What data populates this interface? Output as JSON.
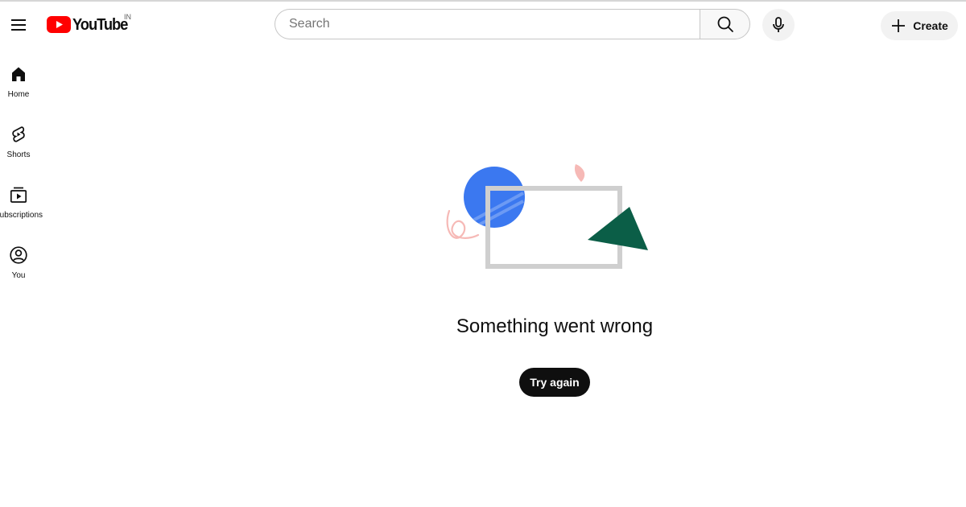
{
  "header": {
    "logo_text": "YouTube",
    "country_code": "IN",
    "brand_color": "#ff0000",
    "search": {
      "placeholder": "Search",
      "value": ""
    },
    "create_label": "Create"
  },
  "sidebar": {
    "items": [
      {
        "label": "Home",
        "icon": "home-icon"
      },
      {
        "label": "Shorts",
        "icon": "shorts-icon"
      },
      {
        "label": "Subscriptions",
        "icon": "subscriptions-icon"
      },
      {
        "label": "You",
        "icon": "you-icon"
      }
    ]
  },
  "main": {
    "error_message": "Something went wrong",
    "retry_label": "Try again"
  },
  "colors": {
    "illustration_blue": "#3b78f0",
    "illustration_green": "#0b5e47",
    "illustration_pink": "#f6b9b6",
    "illustration_frame": "#cfcfcf"
  }
}
